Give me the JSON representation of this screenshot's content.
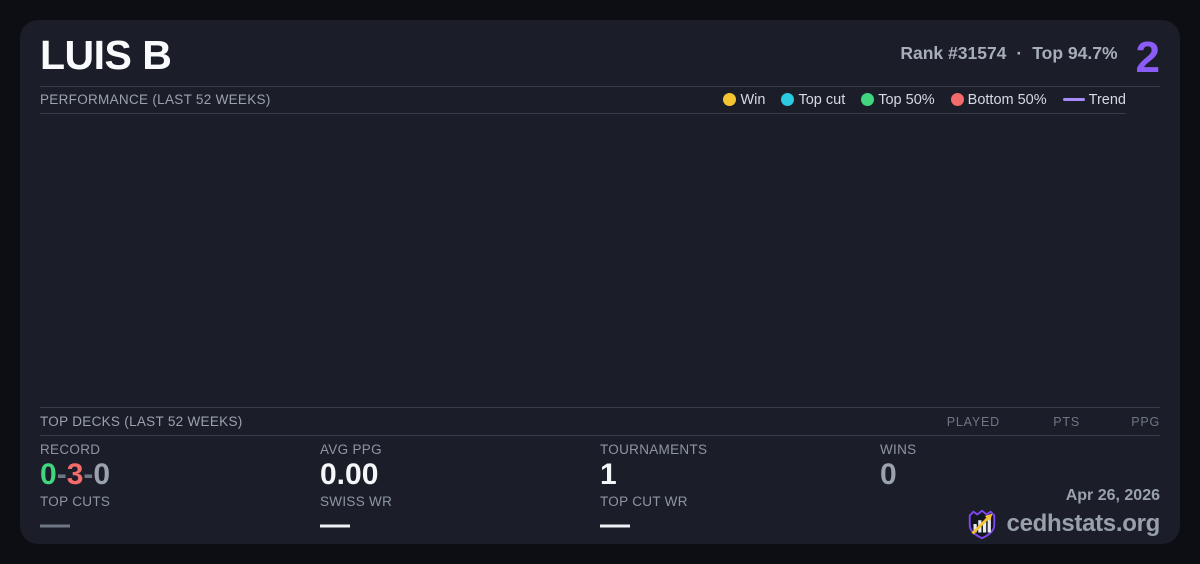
{
  "header": {
    "player_name": "LUIS B",
    "rank_label": "Rank #31574",
    "separator": "·",
    "top_percent_label": "Top 94.7%",
    "score": "2"
  },
  "performance": {
    "title": "PERFORMANCE (LAST 52 WEEKS)",
    "legend": [
      {
        "label": "Win",
        "icon": "win-dot",
        "color": "#f5c531"
      },
      {
        "label": "Top cut",
        "icon": "top-cut-dot",
        "color": "#2cc9e2"
      },
      {
        "label": "Top 50%",
        "icon": "top-50-dot",
        "color": "#41d67e"
      },
      {
        "label": "Bottom 50%",
        "icon": "bottom-50-dot",
        "color": "#f56b6b"
      },
      {
        "label": "Trend",
        "icon": "trend-line",
        "color": "#a78bfa"
      }
    ],
    "chart_points": []
  },
  "top_decks": {
    "title": "TOP DECKS (LAST 52 WEEKS)",
    "columns": [
      "PLAYED",
      "PTS",
      "PPG"
    ],
    "rows": []
  },
  "stats": {
    "record": {
      "label": "RECORD",
      "wins": "0",
      "losses": "3",
      "draws": "0",
      "separator": "-"
    },
    "avg_ppg": {
      "label": "AVG PPG",
      "value": "0.00"
    },
    "tournaments": {
      "label": "TOURNAMENTS",
      "value": "1"
    },
    "wins": {
      "label": "WINS",
      "value": "0"
    },
    "top_cuts": {
      "label": "TOP CUTS",
      "value": "—"
    },
    "swiss_wr": {
      "label": "SWISS WR",
      "value": "—"
    },
    "top_cut_wr": {
      "label": "TOP CUT WR",
      "value": "—"
    }
  },
  "footer": {
    "date": "Apr 26, 2026",
    "brand": "cedhstats.org"
  },
  "colors": {
    "page_background": "#0d0e14",
    "card_background": "#1b1e28",
    "accent_purple": "#8b5cf6",
    "trend_purple": "#a78bfa",
    "win_yellow": "#f5c531",
    "top_cut_cyan": "#2cc9e2",
    "top50_green": "#41d67e",
    "bottom50_red": "#f56b6b",
    "divider_gray": "#363c4a",
    "label_gray": "#8e95a3",
    "value_white": "#f4f6f9"
  }
}
